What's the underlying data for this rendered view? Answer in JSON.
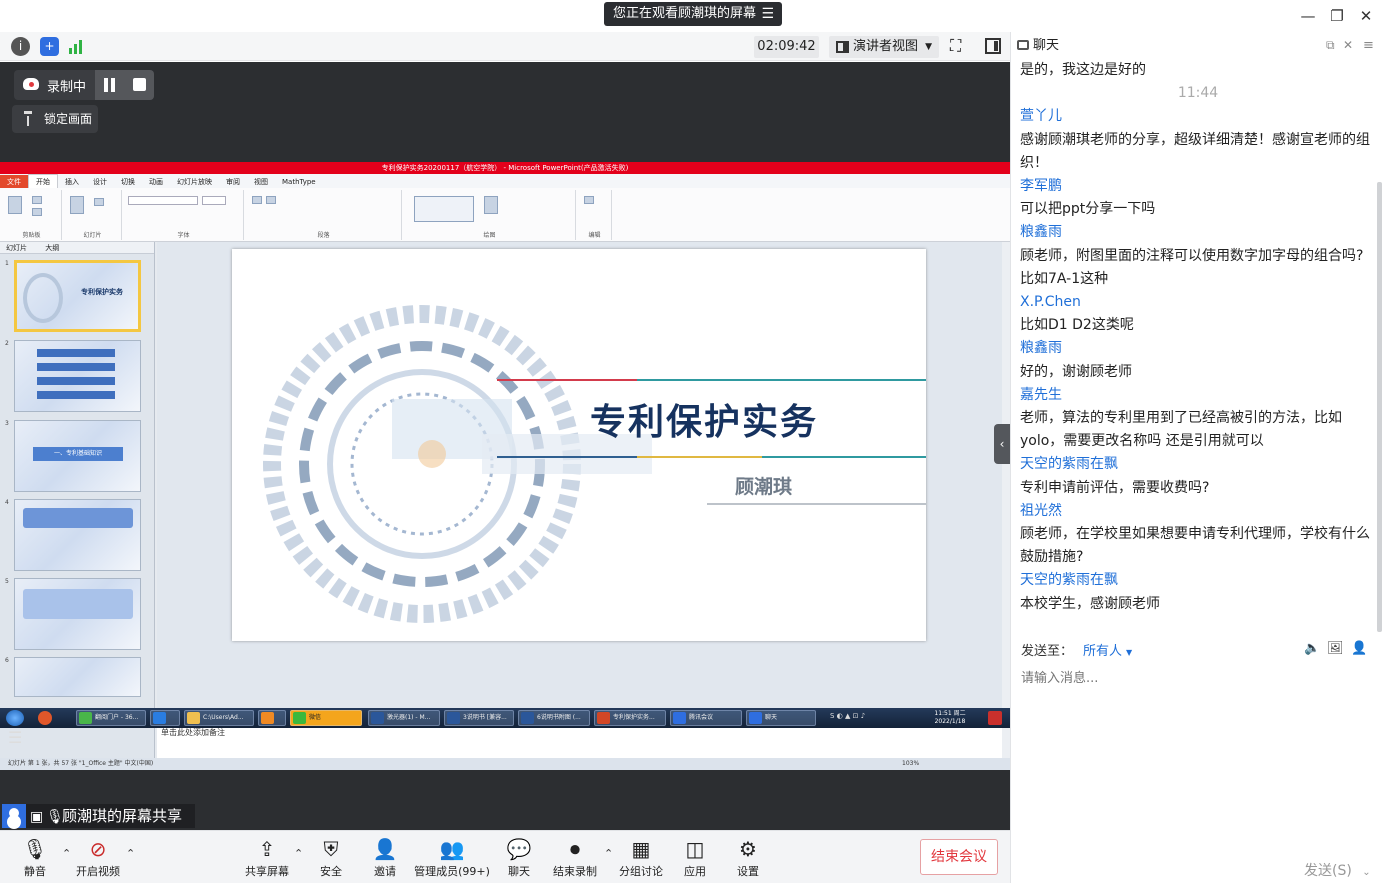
{
  "banner": {
    "text": "您正在观看顾潮琪的屏幕",
    "menu_glyph": "☰"
  },
  "window": {
    "minimize": "—",
    "restore": "❐",
    "close": "✕"
  },
  "toolbar": {
    "timer": "02:09:42",
    "view_mode": "演讲者视图",
    "fullscreen_glyph": "⛶",
    "layout_glyph": "▮"
  },
  "recording": {
    "status": "录制中",
    "lock_label": "锁定画面"
  },
  "ppt": {
    "title": "专利保护实务20200117（航空学院） - Microsoft PowerPoint(产品激活失败)",
    "tabs": [
      "文件",
      "开始",
      "插入",
      "设计",
      "切换",
      "动画",
      "幻灯片放映",
      "审阅",
      "视图",
      "MathType"
    ],
    "groups": [
      "剪贴板",
      "幻灯片",
      "字体",
      "段落",
      "绘图",
      "编辑"
    ],
    "panel_tabs": [
      "幻灯片",
      "大纲"
    ],
    "slide_title": "专利保护实务",
    "slide_author": "顾潮琪",
    "thumb_labels": [
      "专利保护实务",
      "一、专利基础知识"
    ],
    "notes": "单击此处添加备注",
    "status": "幻灯片 第 1 张，共 57 张    \"1_Office 主题\"    中文(中国)",
    "zoom": "103%"
  },
  "taskbar": {
    "items": [
      "翻阅门户 - 36...",
      "",
      "C:\\Users\\Ad...",
      "",
      "微信",
      "激光器(1) - M...",
      "3说明书 [兼容...",
      "6说明书附图 (...",
      "专利保护实务...",
      "腾讯会议",
      "聊天"
    ],
    "time": "11:51 周二",
    "date": "2022/1/18"
  },
  "share_label": "顾潮琪的屏幕共享",
  "bottom": {
    "mute": "静音",
    "video": "开启视频",
    "share": "共享屏幕",
    "security": "安全",
    "invite": "邀请",
    "members": "管理成员(99+)",
    "chat": "聊天",
    "end_record": "结束录制",
    "breakout": "分组讨论",
    "apps": "应用",
    "settings": "设置",
    "end_meeting": "结束会议"
  },
  "chat": {
    "title": "聊天",
    "messages": [
      {
        "kind": "text",
        "text": "是的，我这边是好的"
      },
      {
        "kind": "time",
        "text": "11:44"
      },
      {
        "kind": "name",
        "text": "萱丫儿"
      },
      {
        "kind": "text",
        "text": "感谢顾潮琪老师的分享，超级详细清楚！感谢宣老师的组"
      },
      {
        "kind": "text",
        "text": "织！"
      },
      {
        "kind": "name",
        "text": "李军鹏"
      },
      {
        "kind": "text",
        "text": "可以把ppt分享一下吗"
      },
      {
        "kind": "name",
        "text": "粮鑫雨"
      },
      {
        "kind": "text",
        "text": "顾老师，附图里面的注释可以使用数字加字母的组合吗?"
      },
      {
        "kind": "text",
        "text": "比如7A-1这种"
      },
      {
        "kind": "name",
        "text": "X.P.Chen"
      },
      {
        "kind": "text",
        "text": "比如D1   D2这类呢"
      },
      {
        "kind": "name",
        "text": "粮鑫雨"
      },
      {
        "kind": "text",
        "text": "好的，谢谢顾老师"
      },
      {
        "kind": "name",
        "text": "嘉先生"
      },
      {
        "kind": "text",
        "text": "老师，算法的专利里用到了已经高被引的方法，比如"
      },
      {
        "kind": "text",
        "text": "yolo，需要更改名称吗 还是引用就可以"
      },
      {
        "kind": "name",
        "text": "天空的紫雨在飘"
      },
      {
        "kind": "text",
        "text": "专利申请前评估，需要收费吗?"
      },
      {
        "kind": "name",
        "text": "祖光然"
      },
      {
        "kind": "text",
        "text": "顾老师，在学校里如果想要申请专利代理师，学校有什么"
      },
      {
        "kind": "text",
        "text": "鼓励措施?"
      },
      {
        "kind": "name",
        "text": "天空的紫雨在飘"
      },
      {
        "kind": "text",
        "text": "本校学生，感谢顾老师"
      }
    ],
    "send_to_label": "发送至：",
    "send_to_value": "所有人",
    "input_placeholder": "请输入消息...",
    "send_button": "发送(S)"
  }
}
